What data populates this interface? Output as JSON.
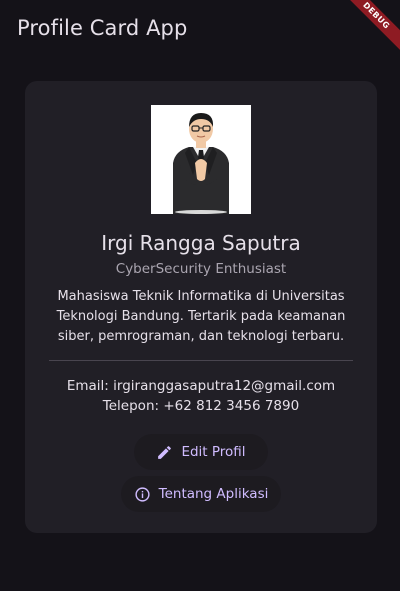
{
  "app_bar": {
    "title": "Profile Card App"
  },
  "debug_banner": {
    "label": "DEBUG"
  },
  "profile": {
    "name": "Irgi Rangga Saputra",
    "role": "CyberSecurity Enthusiast",
    "bio": "Mahasiswa Teknik Informatika di Universitas Teknologi Bandung. Tertarik pada keamanan siber, pemrograman, dan teknologi terbaru.",
    "email": "Email: irgiranggasaputra12@gmail.com",
    "phone": "Telepon: +62 812 3456 7890"
  },
  "actions": {
    "edit_label": "Edit Profil",
    "about_label": "Tentang Aplikasi",
    "edit_icon": "pencil-icon",
    "about_icon": "info-icon"
  },
  "colors": {
    "background": "#141218",
    "card": "#211f26",
    "accent": "#d0bcff",
    "text": "#e6e0e9",
    "muted": "#aaa5b0",
    "debug_ribbon": "#8e1b23"
  }
}
